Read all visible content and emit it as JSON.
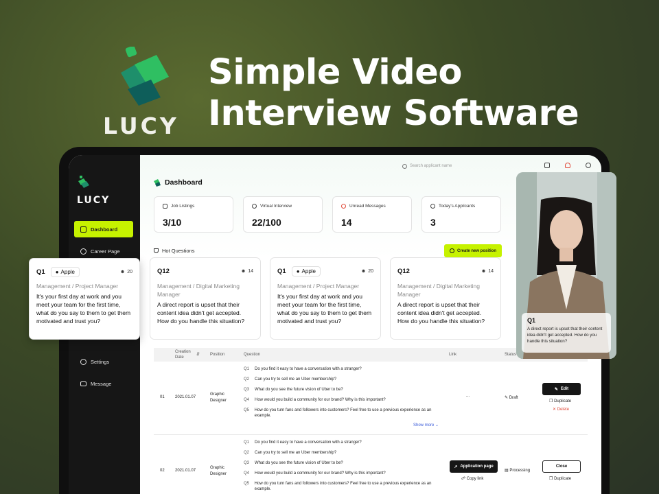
{
  "brand": {
    "name": "LUCY",
    "accent": "#c6f200",
    "logo_colors": [
      "#2fbf62",
      "#1e8f6b",
      "#0e5e5a"
    ]
  },
  "hero": {
    "line1": "Simple Video",
    "line2": "Interview Software"
  },
  "sidebar": {
    "logo_text": "LUCY",
    "items": [
      {
        "label": "Dashboard",
        "icon": "clipboard-icon",
        "active": true
      },
      {
        "label": "Career Page",
        "icon": "target-icon",
        "active": false
      },
      {
        "label": "Settings",
        "icon": "gear-icon",
        "active": false
      },
      {
        "label": "Message",
        "icon": "mail-icon",
        "active": false
      }
    ]
  },
  "topbar": {
    "search_placeholder": "Search applicant name"
  },
  "page": {
    "title": "Dashboard"
  },
  "stats": [
    {
      "label": "Job Listings",
      "value": "3/10",
      "icon": "briefcase-icon"
    },
    {
      "label": "Virtual Interview",
      "value": "22/100",
      "icon": "users-icon"
    },
    {
      "label": "Unread Messages",
      "value": "14",
      "icon": "bell-icon"
    },
    {
      "label": "Today's Applicants",
      "value": "3",
      "icon": "user-plus-icon"
    }
  ],
  "hot_questions": {
    "label": "Hot Questions",
    "create_button": "Create new position",
    "cards": [
      {
        "id": "Q12",
        "tag": "",
        "count": "14",
        "role": "Management / Digital Marketing Manager",
        "text": "A direct report is upset that their content idea didn't get accepted. How do you handle this situation?"
      },
      {
        "id": "Q1",
        "tag": "Apple",
        "count": "20",
        "role": "Management / Project Manager",
        "text": "It's your first day at work and you meet your team for the first time, what do you say to them to get them motivated and trust you?"
      },
      {
        "id": "Q12",
        "tag": "",
        "count": "14",
        "role": "Management / Digital Marketing Manager",
        "text": "A direct report is upset that their content idea didn't get accepted. How do you handle this situation?"
      }
    ]
  },
  "floating_card": {
    "id": "Q1",
    "tag": "Apple",
    "count": "20",
    "role": "Management / Project Manager",
    "text": "It's your first day at work and you meet your team for the first time, what do you say to them to get them motivated and trust you?"
  },
  "table": {
    "headers": {
      "creation_date": "Creation Date",
      "position": "Position",
      "question": "Question",
      "link": "Link",
      "status": "Status"
    },
    "rows": [
      {
        "index": "01",
        "date": "2021.01.07",
        "position": "Graphic Designer",
        "link": "...",
        "status": "Draft",
        "questions": [
          {
            "n": "Q1",
            "text": "Do you find it easy to have a conversation with a stranger?"
          },
          {
            "n": "Q2",
            "text": "Can you try to sell me an Uber membership?"
          },
          {
            "n": "Q3",
            "text": "What do you see the future vision of Uber to be?"
          },
          {
            "n": "Q4",
            "text": "How would you build a community for our brand? Why is this important?"
          },
          {
            "n": "Q5",
            "text": "How do you turn fans and followers into customers? Feel free to use a previous experience as an example."
          }
        ],
        "show_more": "Show more",
        "actions": {
          "primary": "Edit",
          "duplicate": "Duplicate",
          "delete": "Delete"
        }
      },
      {
        "index": "02",
        "date": "2021.01.07",
        "position": "Graphic Designer",
        "status": "Processing",
        "link_button": "Application page",
        "copy_link": "Copy link",
        "questions": [
          {
            "n": "Q1",
            "text": "Do you find it easy to have a conversation with a stranger?"
          },
          {
            "n": "Q2",
            "text": "Can you try to sell me an Uber membership?"
          },
          {
            "n": "Q3",
            "text": "What do you see the future vision of Uber to be?"
          },
          {
            "n": "Q4",
            "text": "How would you build a community for our brand? Why is this important?"
          },
          {
            "n": "Q5",
            "text": "How do you turn fans and followers into customers? Feel free to use a previous experience as an example."
          }
        ],
        "actions": {
          "primary": "Close",
          "duplicate": "Duplicate"
        }
      }
    ]
  },
  "video_panel": {
    "question_id": "Q1",
    "question_text": "A direct report is upset that their content idea didn't get accepted. How do you handle this situation?"
  }
}
